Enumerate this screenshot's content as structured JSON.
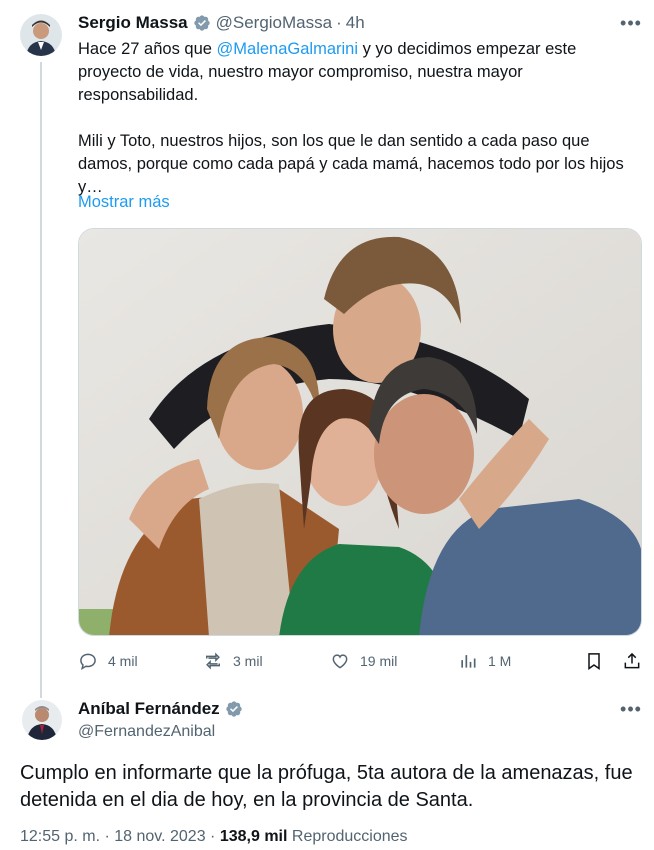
{
  "tweet": {
    "author_name": "Sergio Massa",
    "author_handle": "@SergioMassa",
    "time": "4h",
    "text_part1": "Hace 27 años que ",
    "mention": "@MalenaGalmarini",
    "text_part2": " y yo decidimos empezar este proyecto de vida, nuestro mayor compromiso, nuestra mayor responsabilidad.",
    "paragraph2": "Mili y Toto, nuestros hijos, son los que le dan sentido a cada paso que damos, porque como cada papá y cada mamá, hacemos todo por los hijos y…",
    "show_more": "Mostrar más",
    "stats": {
      "replies": "4 mil",
      "reposts": "3 mil",
      "likes": "19 mil",
      "views": "1 M"
    }
  },
  "reply": {
    "author_name": "Aníbal Fernández",
    "author_handle": "@FernandezAnibal",
    "text": "Cumplo en informarte que la prófuga, 5ta autora de la amenazas, fue detenida en el dia de hoy, en la provincia de Santa.",
    "timestamp": "12:55 p. m. · 18 nov. 2023 · ",
    "views_count": "138,9 mil",
    "views_label": " Reproducciones"
  },
  "icons": {
    "verified": "verified-badge-icon",
    "more": "more-icon",
    "reply": "reply-icon",
    "repost": "repost-icon",
    "like": "like-icon",
    "views": "views-icon",
    "bookmark": "bookmark-icon",
    "share": "share-icon"
  },
  "colors": {
    "accent": "#1d9bf0",
    "muted": "#536471",
    "text": "#0f1419",
    "verified": "#829aab"
  }
}
